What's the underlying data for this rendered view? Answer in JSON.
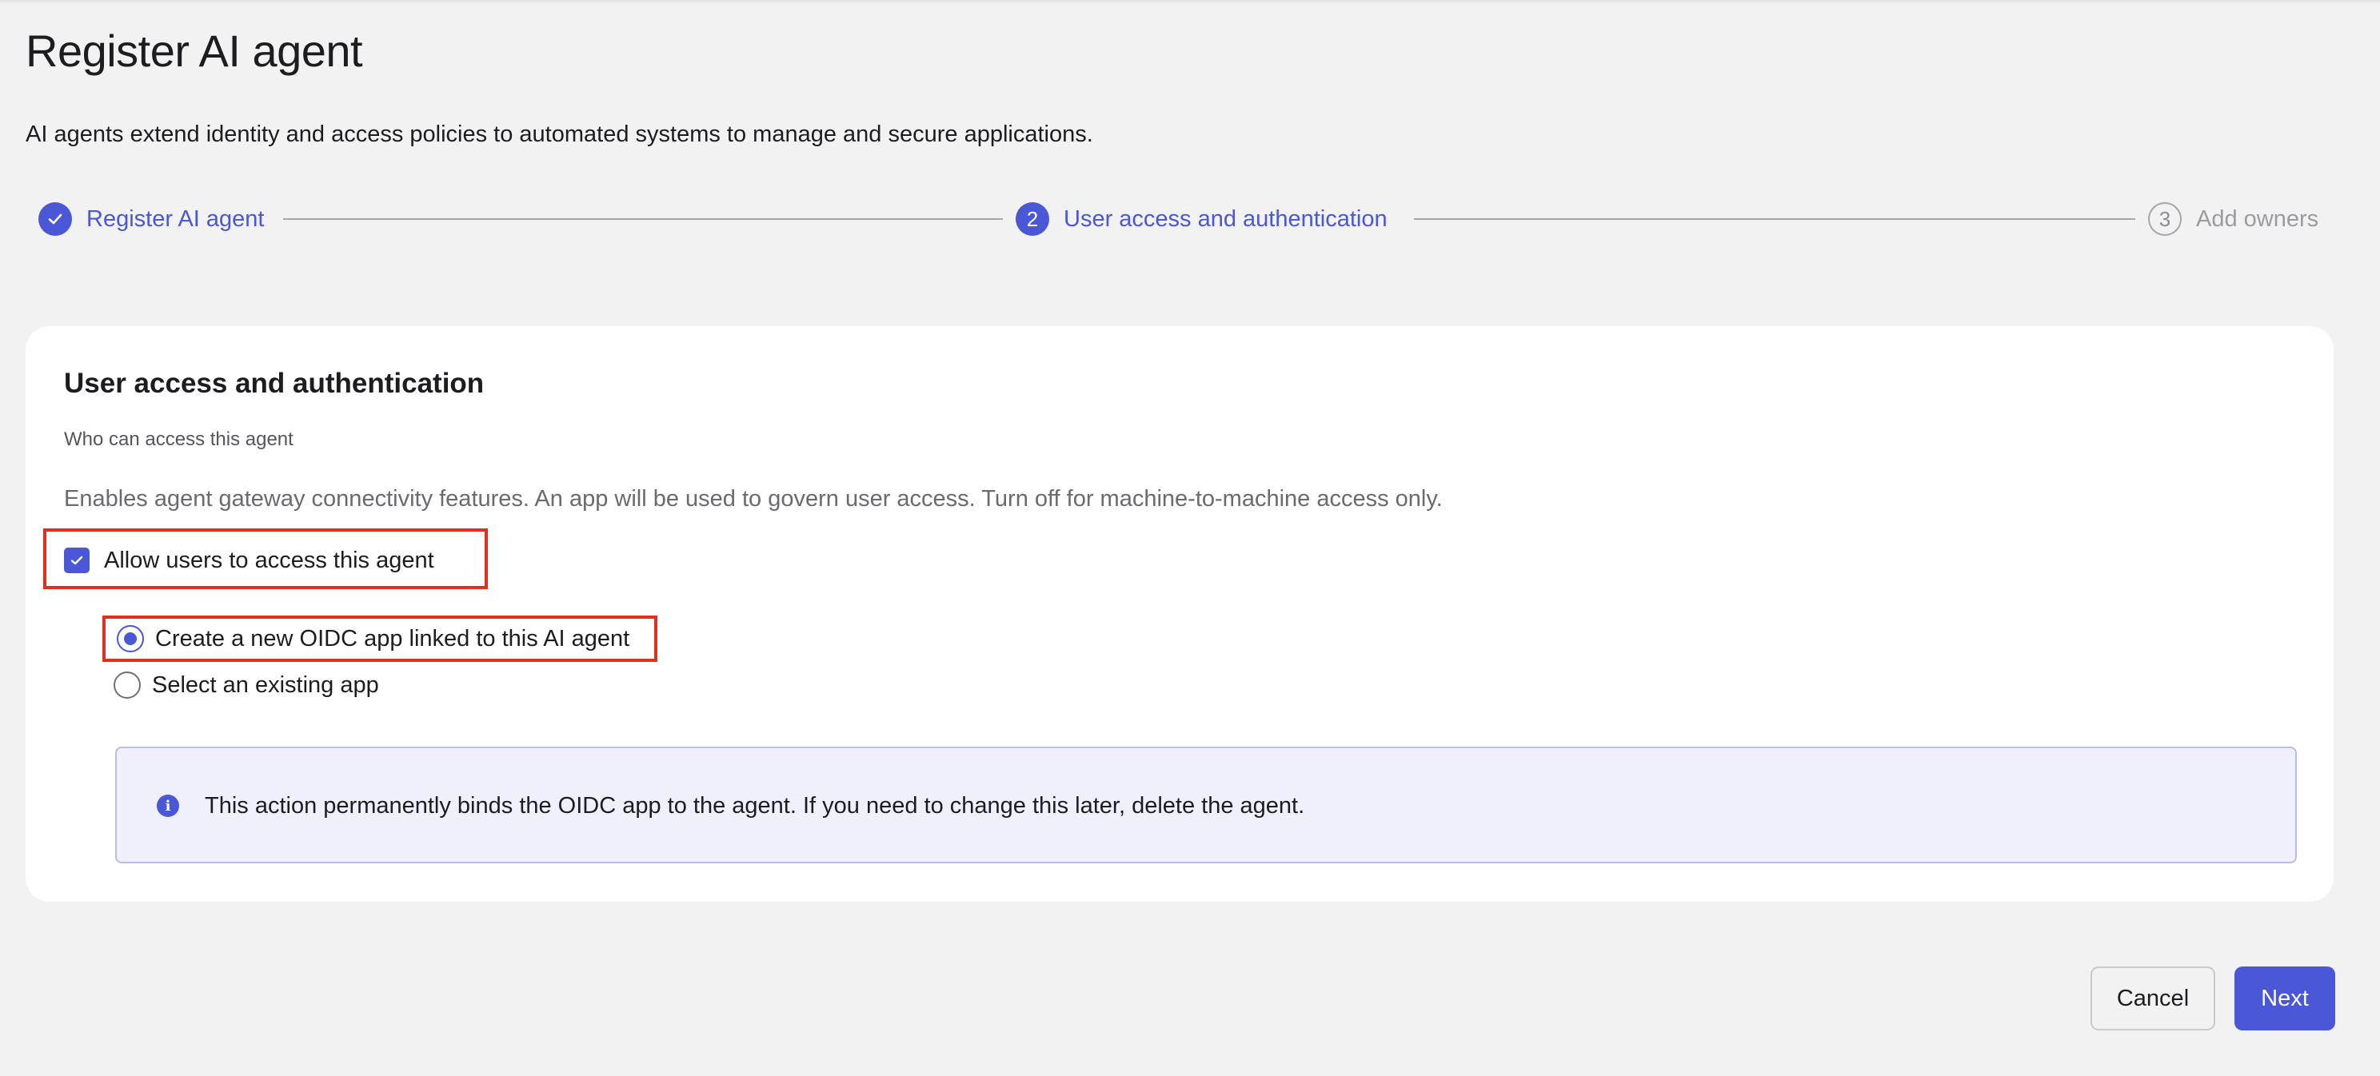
{
  "page": {
    "title": "Register AI agent",
    "description": "AI agents extend identity and access policies to automated systems to manage and secure applications."
  },
  "stepper": {
    "steps": [
      {
        "number": "1",
        "label": "Register AI agent",
        "status": "complete"
      },
      {
        "number": "2",
        "label": "User access and authentication",
        "status": "active"
      },
      {
        "number": "3",
        "label": "Add owners",
        "status": "upcoming"
      }
    ]
  },
  "card": {
    "title": "User access and authentication",
    "section_label": "Who can access this agent",
    "hint": "Enables agent gateway connectivity features. An app will be used to govern user access. Turn off for machine-to-machine access only.",
    "checkbox": {
      "label": "Allow users to access this agent",
      "checked": true
    },
    "radio_options": [
      {
        "label": "Create a new OIDC app linked to this AI agent",
        "selected": true
      },
      {
        "label": "Select an existing app",
        "selected": false
      }
    ],
    "info": {
      "icon": "info-icon",
      "text": "This action permanently binds the OIDC app to the agent. If you need to change this later, delete the agent."
    }
  },
  "footer": {
    "cancel_label": "Cancel",
    "next_label": "Next"
  },
  "colors": {
    "accent": "#4a57d6",
    "highlight_border": "#e02f1f",
    "background": "#f2f2f2",
    "info_bg": "#eff0fb"
  }
}
